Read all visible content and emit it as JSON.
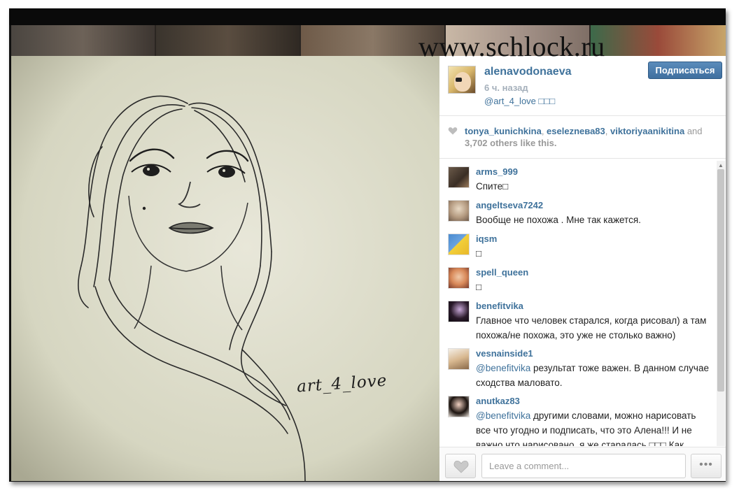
{
  "watermark": "www.schlock.ru",
  "post": {
    "username": "alenavodonaeva",
    "time_ago": "6 ч. назад",
    "caption": "@art_4_love □□□",
    "follow_label": "Подписаться",
    "image_signature": "art_4_love"
  },
  "likes": {
    "users": [
      "tonya_kunichkina",
      "eseleznева83",
      "viktoriyaanikitina"
    ],
    "and_word": " and",
    "count_text": "3,702 others like this."
  },
  "comments": [
    {
      "user": "arms_999",
      "text": "Спите□"
    },
    {
      "user": "angeltseva7242",
      "text": "Вообще не похожа . Мне так кажется."
    },
    {
      "user": "iqsm",
      "text": "□"
    },
    {
      "user": "spell_queen",
      "text": "□"
    },
    {
      "user": "benefitvika",
      "text": "Главное что человек старался, когда рисовал) а там похожа/не похожа, это уже не столько важно)"
    },
    {
      "user": "vesnainside1",
      "mention": "@benefitvika",
      "text": " результат тоже важен. В данном случае сходства маловато."
    },
    {
      "user": "anutkaz83",
      "mention": "@benefitvika",
      "text": " другими словами, можно нарисовать все что угодно и подписать, что это Алена!!! И не важно что нарисовано, я же старалась □□□ Как"
    }
  ],
  "comment_box": {
    "placeholder": "Leave a comment..."
  },
  "more_label": "•••",
  "icons": {
    "like": "heart-icon",
    "more": "ellipsis-icon"
  },
  "colors": {
    "link": "#3f729b",
    "button": "#3f6f9f"
  }
}
